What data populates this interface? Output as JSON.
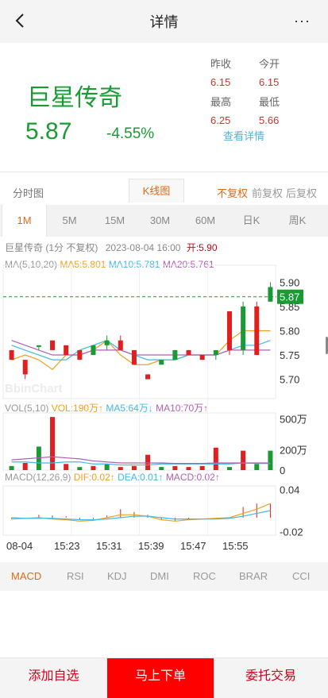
{
  "header": {
    "title": "详情",
    "more": "···"
  },
  "summary": {
    "name": "巨星传奇",
    "price": "5.87",
    "change_pct": "-4.55%",
    "stats": [
      {
        "label": "昨收",
        "value": "6.15"
      },
      {
        "label": "今开",
        "value": "6.15"
      },
      {
        "label": "最高",
        "value": "6.25"
      },
      {
        "label": "最低",
        "value": "5.66"
      }
    ],
    "detail_link": "查看详情"
  },
  "chart_tabs": {
    "fenshi": "分时图",
    "kline": "K线图",
    "adjust": [
      "不复权",
      "前复权",
      "后复权"
    ]
  },
  "periods": [
    "1M",
    "5M",
    "15M",
    "30M",
    "60M",
    "日K",
    "周K"
  ],
  "chart_info": {
    "line1": {
      "name": "巨星传奇",
      "period": "(1分 不复权)",
      "datetime": "2023-08-04  16:00",
      "open": "开:5.90"
    },
    "ma_line": {
      "label": "MA(5,10,20)",
      "ma5": "MA5:5.801",
      "ma10": "MA10:5.781",
      "ma20": "MA20:5.761"
    },
    "vol_line": {
      "label": "VOL(5,10)",
      "vol": "VOL:190万↑",
      "ma5": "MA5:64万↓",
      "ma10": "MA10:70万↑"
    },
    "macd_line": {
      "label": "MACD(12,26,9)",
      "dif": "DIF:0.02↑",
      "dea": "DEA:0.01↑",
      "macd": "MACD:0.02↑"
    },
    "watermark": "BbinChart",
    "price_axis": [
      "5.90",
      "5.85",
      "5.80",
      "5.75",
      "5.70"
    ],
    "current_price_tag": "5.87",
    "vol_axis": [
      "500万",
      "200万",
      "0"
    ],
    "macd_axis": [
      "0.04",
      "-0.02"
    ],
    "time_axis": [
      "08-04",
      "15:23",
      "15:31",
      "15:39",
      "15:47",
      "15:55"
    ]
  },
  "chart_data": [
    {
      "type": "candlestick",
      "title": "巨星传奇 (1分 不复权)",
      "y_ticks": [
        5.9,
        5.85,
        5.8,
        5.75,
        5.7
      ],
      "ylim": [
        5.66,
        5.935
      ],
      "last_price": 5.87,
      "series": [
        {
          "name": "K",
          "candles": [
            {
              "o": 5.76,
              "c": 5.74,
              "h": 5.76,
              "l": 5.74
            },
            {
              "o": 5.74,
              "c": 5.71,
              "h": 5.74,
              "l": 5.7
            },
            {
              "o": 5.77,
              "c": 5.77,
              "h": 5.77,
              "l": 5.76
            },
            {
              "o": 5.78,
              "c": 5.76,
              "h": 5.78,
              "l": 5.76
            },
            {
              "o": 5.77,
              "c": 5.75,
              "h": 5.77,
              "l": 5.75
            },
            {
              "o": 5.76,
              "c": 5.74,
              "h": 5.76,
              "l": 5.74
            },
            {
              "o": 5.75,
              "c": 5.77,
              "h": 5.77,
              "l": 5.75
            },
            {
              "o": 5.77,
              "c": 5.78,
              "h": 5.79,
              "l": 5.76
            },
            {
              "o": 5.78,
              "c": 5.76,
              "h": 5.79,
              "l": 5.76
            },
            {
              "o": 5.76,
              "c": 5.73,
              "h": 5.76,
              "l": 5.73
            },
            {
              "o": 5.71,
              "c": 5.7,
              "h": 5.71,
              "l": 5.7
            },
            {
              "o": 5.73,
              "c": 5.74,
              "h": 5.74,
              "l": 5.73
            },
            {
              "o": 5.74,
              "c": 5.76,
              "h": 5.76,
              "l": 5.74
            },
            {
              "o": 5.76,
              "c": 5.75,
              "h": 5.76,
              "l": 5.75
            },
            {
              "o": 5.75,
              "c": 5.74,
              "h": 5.75,
              "l": 5.74
            },
            {
              "o": 5.75,
              "c": 5.76,
              "h": 5.76,
              "l": 5.74
            },
            {
              "o": 5.84,
              "c": 5.76,
              "h": 5.84,
              "l": 5.75
            },
            {
              "o": 5.76,
              "c": 5.85,
              "h": 5.86,
              "l": 5.75
            },
            {
              "o": 5.85,
              "c": 5.75,
              "h": 5.86,
              "l": 5.75
            },
            {
              "o": 5.86,
              "c": 5.89,
              "h": 5.9,
              "l": 5.86
            }
          ]
        },
        {
          "name": "MA5",
          "values": [
            5.74,
            5.75,
            5.74,
            5.72,
            5.75,
            5.75,
            5.76,
            5.78,
            5.75,
            5.73,
            5.73,
            5.74,
            5.74,
            5.75,
            5.75,
            5.75,
            5.78,
            5.8,
            5.8,
            5.8
          ]
        },
        {
          "name": "MA10",
          "values": [
            5.77,
            5.76,
            5.75,
            5.74,
            5.74,
            5.76,
            5.77,
            5.78,
            5.76,
            5.75,
            5.74,
            5.74,
            5.74,
            5.75,
            5.75,
            5.75,
            5.76,
            5.77,
            5.77,
            5.78
          ]
        },
        {
          "name": "MA20",
          "values": [
            5.78,
            5.77,
            5.76,
            5.75,
            5.75,
            5.75,
            5.76,
            5.76,
            5.76,
            5.75,
            5.75,
            5.75,
            5.75,
            5.75,
            5.75,
            5.75,
            5.76,
            5.76,
            5.76,
            5.76
          ]
        }
      ]
    },
    {
      "type": "bar",
      "title": "VOL(5,10)",
      "y_ticks": [
        500,
        200,
        0
      ],
      "unit": "万",
      "series": [
        {
          "name": "VOL",
          "values": [
            40,
            70,
            230,
            520,
            60,
            30,
            40,
            60,
            30,
            40,
            150,
            30,
            40,
            30,
            40,
            220,
            30,
            190,
            60,
            190
          ],
          "colors": [
            "g",
            "r",
            "g",
            "r",
            "r",
            "g",
            "r",
            "g",
            "r",
            "r",
            "r",
            "g",
            "r",
            "r",
            "r",
            "r",
            "g",
            "r",
            "g",
            "g"
          ]
        },
        {
          "name": "MA5",
          "values": [
            80,
            80,
            70,
            70,
            80,
            80,
            60,
            60,
            50,
            50,
            50,
            60,
            60,
            60,
            60,
            60,
            60,
            70,
            65,
            64
          ]
        },
        {
          "name": "MA10",
          "values": [
            100,
            110,
            120,
            130,
            120,
            110,
            90,
            80,
            70,
            70,
            70,
            70,
            65,
            65,
            65,
            70,
            70,
            70,
            70,
            70
          ]
        }
      ]
    },
    {
      "type": "bar",
      "title": "MACD(12,26,9)",
      "y_ticks": [
        0.04,
        -0.02
      ],
      "series": [
        {
          "name": "MACD",
          "values": [
            -0.002,
            0,
            0.004,
            0.003,
            0.002,
            -0.003,
            -0.002,
            0.003,
            0.012,
            0.008,
            0.004,
            -0.003,
            -0.005,
            -0.002,
            0,
            0,
            0,
            0.015,
            0.02,
            0.02
          ]
        },
        {
          "name": "DIF",
          "values": [
            -0.002,
            -0.001,
            0.0,
            -0.002,
            -0.003,
            -0.005,
            -0.004,
            0.0,
            0.004,
            0.004,
            0.002,
            -0.003,
            -0.005,
            -0.003,
            -0.002,
            -0.001,
            0.0,
            0.006,
            0.012,
            0.02
          ]
        },
        {
          "name": "DEA",
          "values": [
            0.0,
            -0.001,
            -0.001,
            -0.001,
            -0.002,
            -0.003,
            -0.003,
            -0.002,
            0.0,
            0.002,
            0.002,
            0.0,
            -0.002,
            -0.002,
            -0.002,
            -0.002,
            -0.001,
            0.002,
            0.006,
            0.01
          ]
        }
      ]
    }
  ],
  "indicators": [
    "MACD",
    "RSI",
    "KDJ",
    "DMI",
    "ROC",
    "BRAR",
    "CCI"
  ],
  "bottom": {
    "watch": "添加自选",
    "order": "马上下单",
    "entrust": "委托交易"
  },
  "colors": {
    "up": "#e02020",
    "down": "#1a9a33",
    "accent": "#e06a1a",
    "ma5": "#f0a020",
    "ma10": "#3fb9e8",
    "ma20": "#b05fb5"
  }
}
